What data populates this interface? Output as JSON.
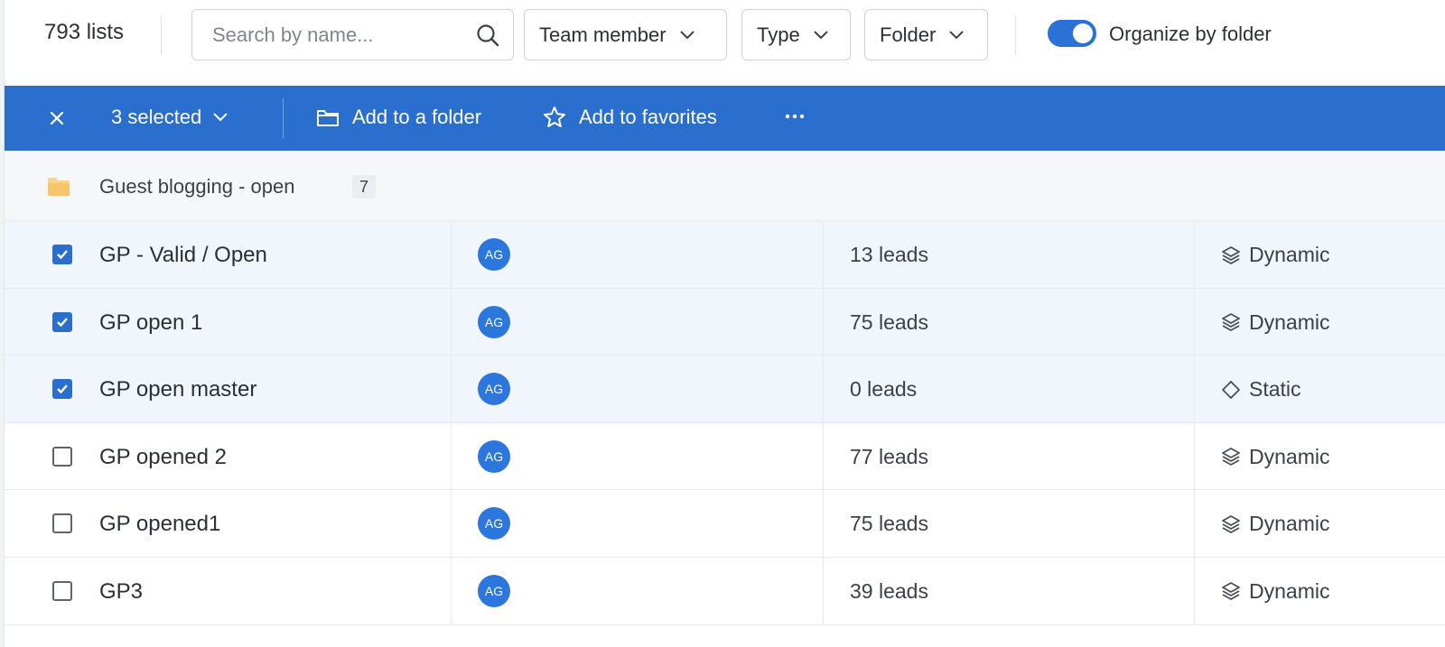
{
  "header": {
    "list_count": "793",
    "list_count_suffix": " lists",
    "search_placeholder": "Search by name...",
    "filters": [
      {
        "label": "Team member"
      },
      {
        "label": "Type"
      },
      {
        "label": "Folder"
      }
    ],
    "organize_toggle": {
      "label": "Organize by folder",
      "on": true
    }
  },
  "action_bar": {
    "selected_label": "3 selected",
    "add_to_folder": "Add to a folder",
    "add_to_favorites": "Add to favorites",
    "more_icon": "more-horizontal-icon",
    "color": "#2a6fce"
  },
  "folder": {
    "name": "Guest blogging - open",
    "count": "7",
    "icon": "folder-icon",
    "icon_color": "#f5cd7e"
  },
  "rows": [
    {
      "name": "GP - Valid / Open",
      "owner": "AG",
      "leads": "13 leads",
      "type": "Dynamic",
      "selected": true
    },
    {
      "name": "GP open 1",
      "owner": "AG",
      "leads": "75 leads",
      "type": "Dynamic",
      "selected": true
    },
    {
      "name": "GP open master",
      "owner": "AG",
      "leads": "0 leads",
      "type": "Static",
      "selected": true
    },
    {
      "name": "GP opened 2",
      "owner": "AG",
      "leads": "77 leads",
      "type": "Dynamic",
      "selected": false
    },
    {
      "name": "GP opened1",
      "owner": "AG",
      "leads": "75 leads",
      "type": "Dynamic",
      "selected": false
    },
    {
      "name": "GP3",
      "owner": "AG",
      "leads": "39 leads",
      "type": "Dynamic",
      "selected": false
    }
  ],
  "colors": {
    "accent": "#2a6fce",
    "avatar": "#2b77dd",
    "selected_row": "#f1f6fd"
  }
}
